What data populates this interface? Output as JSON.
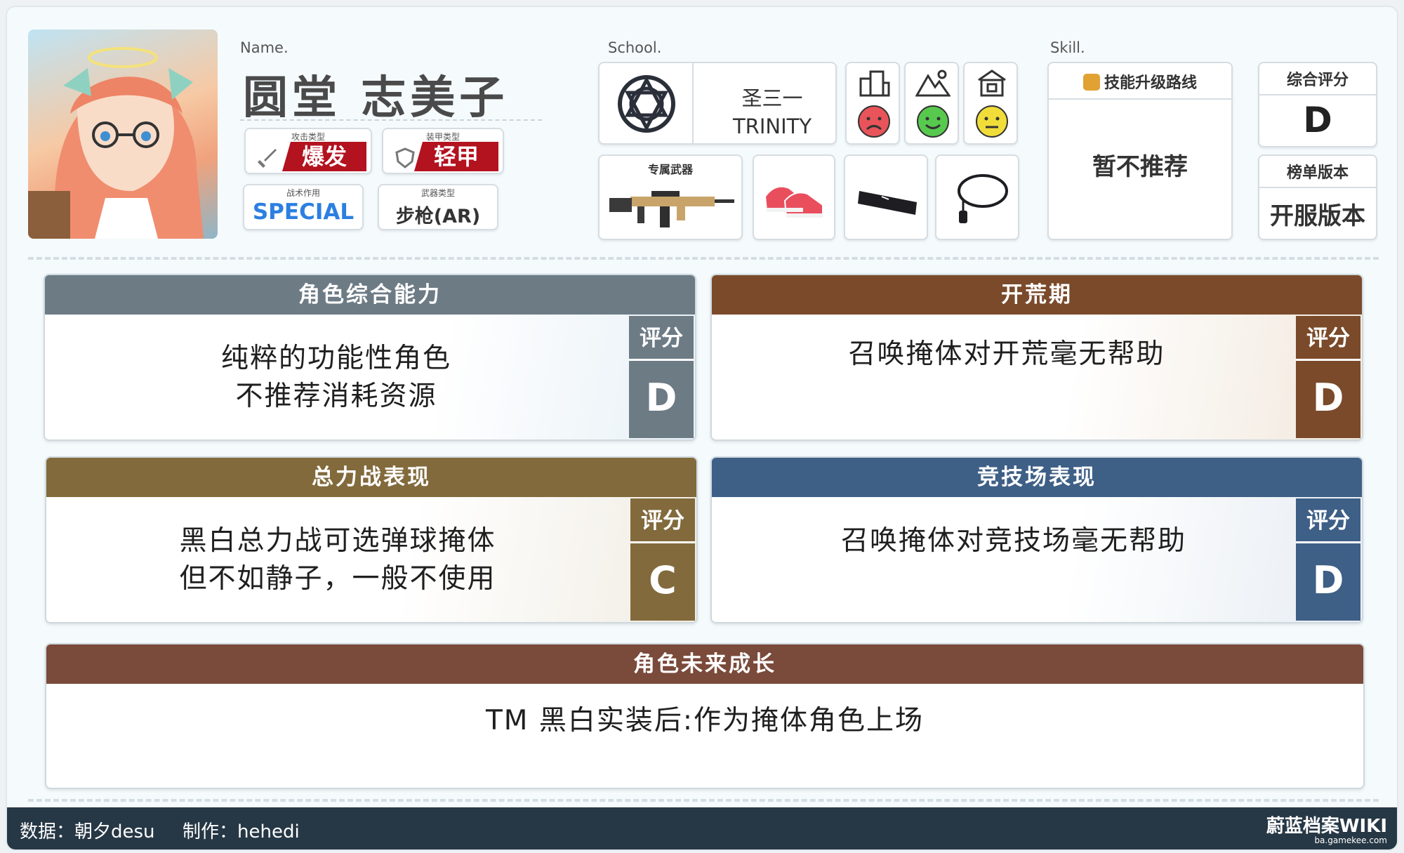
{
  "header": {
    "name_label": "Name.",
    "character_name": "圆堂 志美子",
    "school_label": "School.",
    "skill_label": "Skill.",
    "attack_type": {
      "caption": "攻击类型",
      "value": "爆发"
    },
    "armor_type": {
      "caption": "装甲类型",
      "value": "轻甲"
    },
    "tactical_role": {
      "caption": "战术作用",
      "value": "SPECIAL"
    },
    "weapon_type": {
      "caption": "武器类型",
      "value": "步枪(AR)"
    },
    "school": {
      "name_cn": "圣三一",
      "name_en": "TRINITY"
    },
    "terrain": [
      {
        "icon": "city-icon",
        "mood": "sad-face-icon",
        "color": "#e8545a"
      },
      {
        "icon": "outdoor-icon",
        "mood": "happy-face-icon",
        "color": "#58c94f"
      },
      {
        "icon": "indoor-icon",
        "mood": "neutral-face-icon",
        "color": "#f1dd3a"
      }
    ],
    "exclusive_weapon_label": "专属武器",
    "equipment": [
      "shoes-icon",
      "hairband-icon",
      "necklace-icon"
    ],
    "skill": {
      "title": "技能升级路线",
      "value": "暂不推荐"
    },
    "overall": {
      "title": "综合评分",
      "value": "D"
    },
    "version": {
      "title": "榜单版本",
      "value": "开服版本"
    }
  },
  "panels": {
    "overall": {
      "title": "角色综合能力",
      "line1": "纯粹的功能性角色",
      "line2": "不推荐消耗资源",
      "score_label": "评分",
      "score": "D",
      "color": "#6d7b85"
    },
    "early": {
      "title": "开荒期",
      "line1": "召唤掩体对开荒毫无帮助",
      "score_label": "评分",
      "score": "D",
      "color": "#7a4a2a"
    },
    "raid": {
      "title": "总力战表现",
      "line1": "黑白总力战可选弹球掩体",
      "line2": "但不如静子，一般不使用",
      "score_label": "评分",
      "score": "C",
      "color": "#826a3c"
    },
    "arena": {
      "title": "竞技场表现",
      "line1": "召唤掩体对竞技场毫无帮助",
      "score_label": "评分",
      "score": "D",
      "color": "#3e5f86"
    },
    "future": {
      "title": "角色未来成长",
      "line1": "TM 黑白实装后:作为掩体角色上场",
      "color": "#7a4a3a"
    }
  },
  "footer": {
    "data_credit": "数据：朝夕desu",
    "author_credit": "制作：hehedi",
    "brand": "蔚蓝档案WIKI",
    "site": "ba.gamekee.com"
  }
}
